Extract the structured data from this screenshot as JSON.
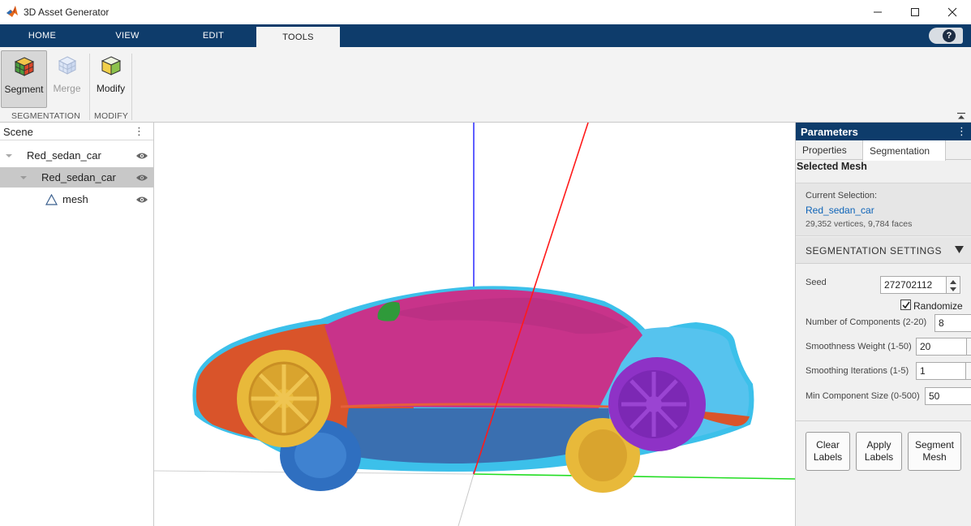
{
  "window": {
    "title": "3D Asset Generator"
  },
  "tabs": [
    {
      "label": "HOME",
      "active": false
    },
    {
      "label": "VIEW",
      "active": false
    },
    {
      "label": "EDIT",
      "active": false
    },
    {
      "label": "TOOLS",
      "active": true
    }
  ],
  "help": {
    "label": "?"
  },
  "toolstrip": {
    "groups": [
      {
        "label": "SEGMENTATION",
        "buttons": [
          {
            "label": "Segment",
            "icon": "segment-cube-icon",
            "state": "pressed"
          },
          {
            "label": "Merge",
            "icon": "merge-cube-icon",
            "state": "disabled"
          }
        ]
      },
      {
        "label": "MODIFY",
        "buttons": [
          {
            "label": "Modify",
            "icon": "modify-cube-icon",
            "state": "enabled"
          }
        ]
      }
    ]
  },
  "scene": {
    "title": "Scene",
    "menu": "⋮",
    "tree": [
      {
        "label": "Red_sedan_car",
        "level": 0,
        "icon": "caret-down-icon",
        "visible": true
      },
      {
        "label": "Red_sedan_car",
        "level": 1,
        "icon": "caret-down-icon",
        "visible": true,
        "selected": true
      },
      {
        "label": "mesh",
        "level": 2,
        "icon": "mesh-triangle-icon",
        "visible": true
      }
    ]
  },
  "viewport": {
    "axes": {
      "x_color": "#ff1a1a",
      "y_color": "#22dd22",
      "z_color": "#1a1aff"
    },
    "segment_colors": {
      "body_top": "#c8338a",
      "body_front": "#d9542a",
      "body_rear": "#44b4e8",
      "lower_body": "#3a6fb0",
      "front_wheel": "#e8b93a",
      "rear_wheel_near": "#8e32c6",
      "rear_wheel_far": "#e8b93a",
      "front_wheel_far": "#2f6fc0",
      "mirror": "#2f9a3a",
      "outline": "#3cc0ea"
    }
  },
  "parameters": {
    "title": "Parameters",
    "menu": "⋮",
    "tabs": [
      {
        "label": "Properties",
        "active": false
      },
      {
        "label": "Segmentation",
        "active": true
      }
    ],
    "selected_mesh_heading": "Selected Mesh",
    "current_selection_label": "Current Selection:",
    "current_selection_name": "Red_sedan_car",
    "current_selection_stats": "29,352 vertices, 9,784 faces",
    "segmentation_settings_title": "SEGMENTATION SETTINGS",
    "seed": {
      "label": "Seed",
      "value": "272702112"
    },
    "randomize": {
      "label": "Randomize",
      "checked": true
    },
    "num_components": {
      "label": "Number of Components (2-20)",
      "value": "8"
    },
    "smoothness_weight": {
      "label": "Smoothness Weight (1-50)",
      "value": "20"
    },
    "smoothing_iterations": {
      "label": "Smoothing Iterations (1-5)",
      "value": "1"
    },
    "min_component_size": {
      "label": "Min Component Size (0-500)",
      "value": "50"
    },
    "buttons": {
      "clear": "Clear\nLabels",
      "apply": "Apply\nLabels",
      "segment": "Segment\nMesh"
    }
  }
}
